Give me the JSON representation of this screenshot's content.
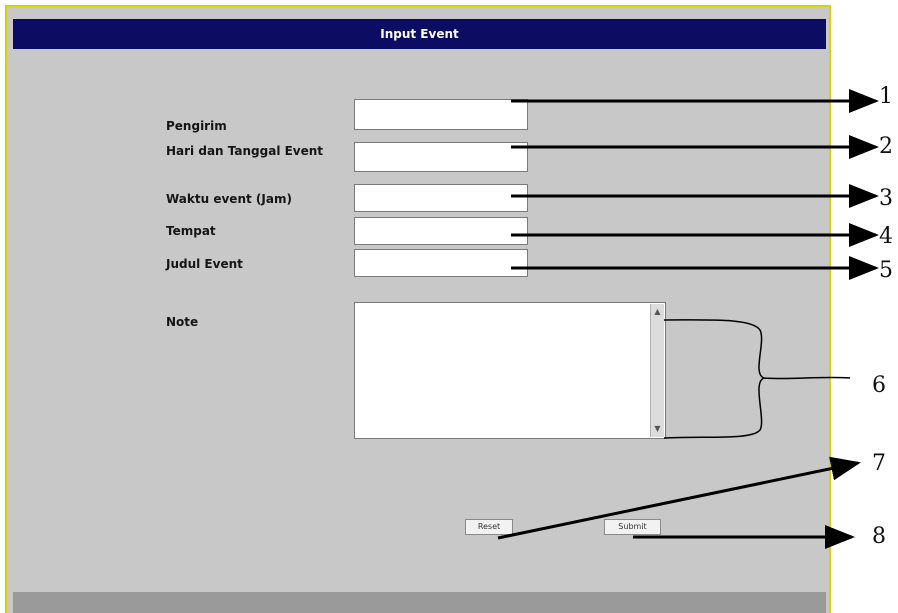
{
  "window": {
    "title": "Input Event"
  },
  "form": {
    "fields": [
      {
        "label": "Pengirim",
        "value": ""
      },
      {
        "label": "Hari dan Tanggal Event",
        "value": ""
      },
      {
        "label": "Waktu event (Jam)",
        "value": ""
      },
      {
        "label": "Tempat",
        "value": ""
      },
      {
        "label": "Judul Event",
        "value": ""
      }
    ],
    "note": {
      "label": "Note",
      "value": ""
    },
    "buttons": {
      "reset_label": "Reset",
      "submit_label": "Submit"
    }
  },
  "annotations": [
    "1",
    "2",
    "3",
    "4",
    "5",
    "6",
    "7",
    "8"
  ]
}
